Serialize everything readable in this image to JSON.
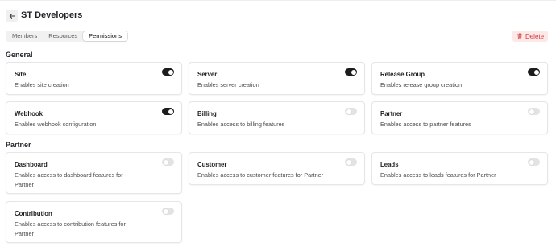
{
  "header": {
    "title": "ST Developers",
    "back_icon": "arrow-left-icon"
  },
  "tabs": [
    {
      "label": "Members",
      "active": false
    },
    {
      "label": "Resources",
      "active": false
    },
    {
      "label": "Permissions",
      "active": true
    }
  ],
  "delete_button": {
    "label": "Delete",
    "icon": "trash-icon",
    "color": "#d23a3a"
  },
  "sections": [
    {
      "title": "General",
      "permissions": [
        {
          "title": "Site",
          "description": "Enables site creation",
          "enabled": true
        },
        {
          "title": "Server",
          "description": "Enables server creation",
          "enabled": true
        },
        {
          "title": "Release Group",
          "description": "Enables release group creation",
          "enabled": true
        },
        {
          "title": "Webhook",
          "description": "Enables webhook configuration",
          "enabled": true
        },
        {
          "title": "Billing",
          "description": "Enables access to billing features",
          "enabled": false
        },
        {
          "title": "Partner",
          "description": "Enables access to partner features",
          "enabled": false
        }
      ]
    },
    {
      "title": "Partner",
      "permissions": [
        {
          "title": "Dashboard",
          "description": "Enables access to dashboard features for Partner",
          "enabled": false
        },
        {
          "title": "Customer",
          "description": "Enables access to customer features for Partner",
          "enabled": false
        },
        {
          "title": "Leads",
          "description": "Enables access to leads features for Partner",
          "enabled": false
        },
        {
          "title": "Contribution",
          "description": "Enables access to contribution features for Partner",
          "enabled": false
        }
      ]
    }
  ]
}
